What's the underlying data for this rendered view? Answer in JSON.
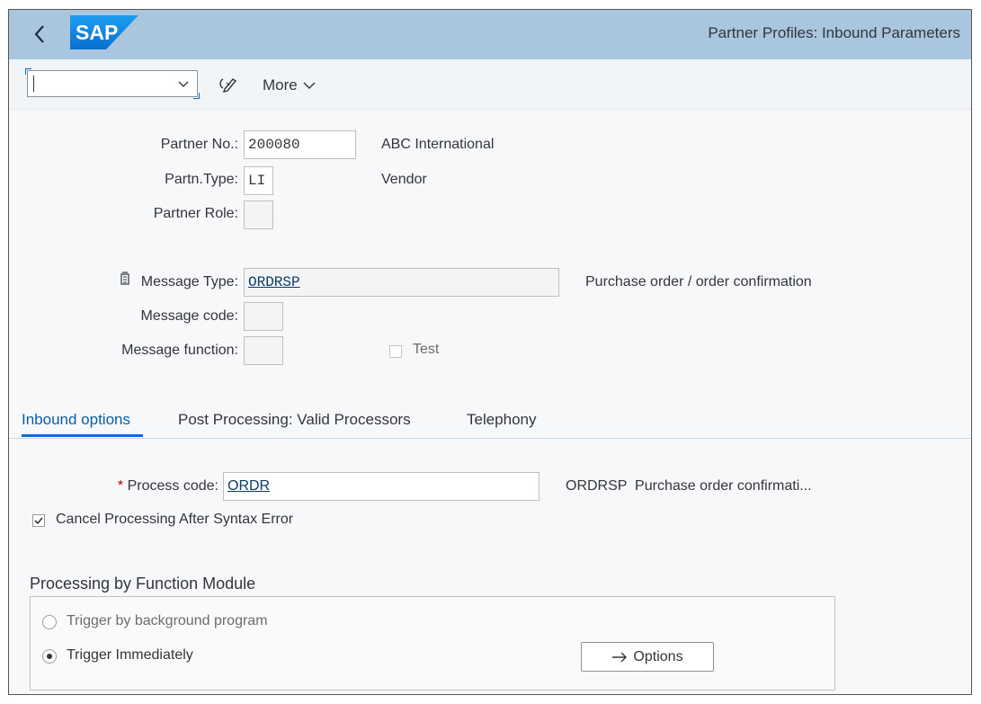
{
  "shell": {
    "logo_text": "SAP",
    "title": "Partner Profiles: Inbound Parameters"
  },
  "toolbar": {
    "command_value": "",
    "more_label": "More"
  },
  "header": {
    "partner_no_label": "Partner No.:",
    "partner_no_value": "200080",
    "partner_no_desc": "ABC International",
    "partn_type_label": "Partn.Type:",
    "partn_type_value": "LI",
    "partn_type_desc": "Vendor",
    "partner_role_label": "Partner Role:",
    "partner_role_value": "",
    "message_type_label": "Message Type:",
    "message_type_value": "ORDRSP",
    "message_type_desc": "Purchase order / order confirmation",
    "message_code_label": "Message code:",
    "message_code_value": "",
    "message_function_label": "Message function:",
    "message_function_value": "",
    "test_label": "Test",
    "test_checked": false
  },
  "tabs": [
    {
      "label": "Inbound options",
      "active": true
    },
    {
      "label": "Post Processing: Valid Processors",
      "active": false
    },
    {
      "label": "Telephony",
      "active": false
    }
  ],
  "inbound": {
    "required_marker": "*",
    "process_code_label": "Process code:",
    "process_code_value": "ORDR",
    "process_code_desc": "ORDRSP  Purchase order confirmati...",
    "cancel_label": "Cancel Processing After Syntax Error",
    "cancel_checked": true,
    "section_title": "Processing by Function Module",
    "radio_background": "Trigger by background program",
    "radio_immediately": "Trigger Immediately",
    "options_button": "Options",
    "selected_trigger": "Trigger Immediately"
  },
  "colors": {
    "shell_bar": "#a9c6de",
    "accent": "#0a6ed1",
    "text": "#32363a"
  }
}
